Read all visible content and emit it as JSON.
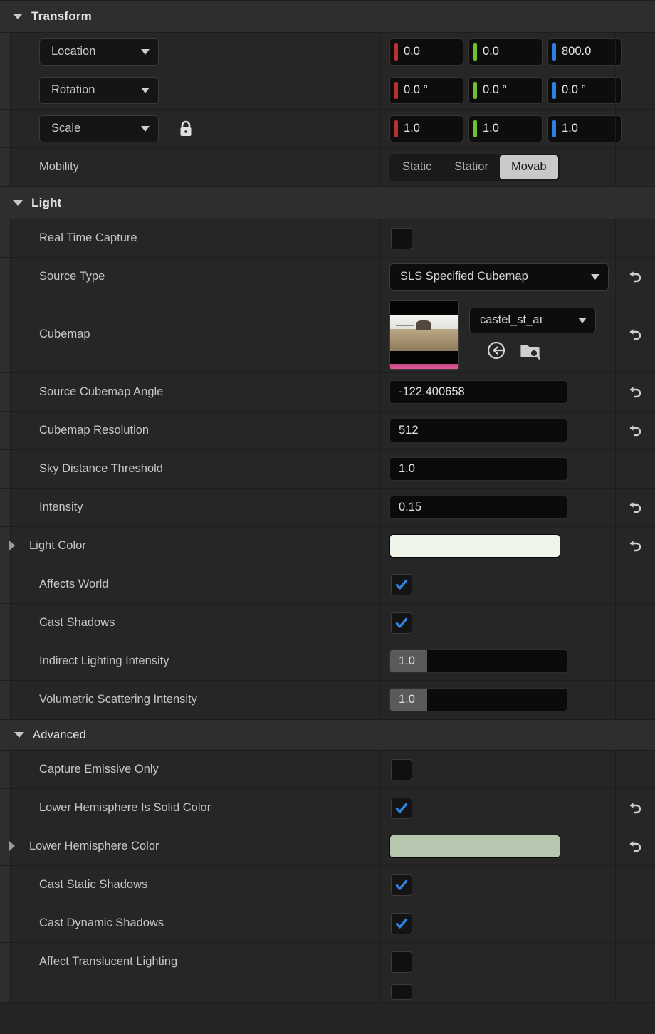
{
  "sections": {
    "transform": {
      "title": "Transform",
      "expanded_icon": "chevron-down-icon",
      "location": {
        "label": "Location",
        "x": "0.0",
        "y": "0.0",
        "z": "800.0",
        "axis_colors": {
          "x": "#b83030",
          "y": "#6fbf2e",
          "z": "#2f7fe0"
        }
      },
      "rotation": {
        "label": "Rotation",
        "x": "0.0 °",
        "y": "0.0 °",
        "z": "0.0 °"
      },
      "scale": {
        "label": "Scale",
        "lock_icon": "lock-icon",
        "x": "1.0",
        "y": "1.0",
        "z": "1.0"
      },
      "mobility": {
        "label": "Mobility",
        "options": [
          "Static",
          "Statior",
          "Movab"
        ],
        "selected": "Movab"
      }
    },
    "light": {
      "title": "Light",
      "real_time_capture": {
        "label": "Real Time Capture",
        "checked": false
      },
      "source_type": {
        "label": "Source Type",
        "value": "SLS Specified Cubemap",
        "has_revert": true
      },
      "cubemap": {
        "label": "Cubemap",
        "asset_name": "castel_st_aı",
        "browse_icon": "browse-to-asset-icon",
        "use_selected_icon": "use-selected-asset-icon",
        "thumbnail_name": "cubemap-thumbnail",
        "has_revert": true
      },
      "source_cubemap_angle": {
        "label": "Source Cubemap Angle",
        "value": "-122.400658",
        "has_revert": true
      },
      "cubemap_resolution": {
        "label": "Cubemap Resolution",
        "value": "512",
        "has_revert": true
      },
      "sky_distance_threshold": {
        "label": "Sky Distance Threshold",
        "value": "1.0",
        "has_revert": false
      },
      "intensity": {
        "label": "Intensity",
        "value": "0.15",
        "has_revert": true
      },
      "light_color": {
        "label": "Light Color",
        "color": "#eff6e9",
        "has_revert": true,
        "expandable": true
      },
      "affects_world": {
        "label": "Affects World",
        "checked": true
      },
      "cast_shadows": {
        "label": "Cast Shadows",
        "checked": true
      },
      "indirect_lighting_intensity": {
        "label": "Indirect Lighting Intensity",
        "value": "1.0",
        "slider": true
      },
      "volumetric_scattering_intensity": {
        "label": "Volumetric Scattering Intensity",
        "value": "1.0",
        "slider": true
      }
    },
    "advanced": {
      "title": "Advanced",
      "capture_emissive_only": {
        "label": "Capture Emissive Only",
        "checked": false
      },
      "lower_hemisphere_is_solid_color": {
        "label": "Lower Hemisphere Is Solid Color",
        "checked": true,
        "has_revert": true
      },
      "lower_hemisphere_color": {
        "label": "Lower Hemisphere Color",
        "color": "#b5c7af",
        "has_revert": true,
        "expandable": true
      },
      "cast_static_shadows": {
        "label": "Cast Static Shadows",
        "checked": true
      },
      "cast_dynamic_shadows": {
        "label": "Cast Dynamic Shadows",
        "checked": true
      },
      "affect_translucent_lighting": {
        "label": "Affect Translucent Lighting",
        "checked": false
      }
    }
  },
  "icons": {
    "revert": "revert-arrow-icon",
    "checkmark": "checkmark-icon"
  },
  "colors": {
    "checkbox_check": "#2f86e8",
    "selected_segment_bg": "#c9c9c9",
    "panel_bg": "#242424",
    "row_bg": "#262626",
    "header_bg": "#2e2e2e"
  }
}
